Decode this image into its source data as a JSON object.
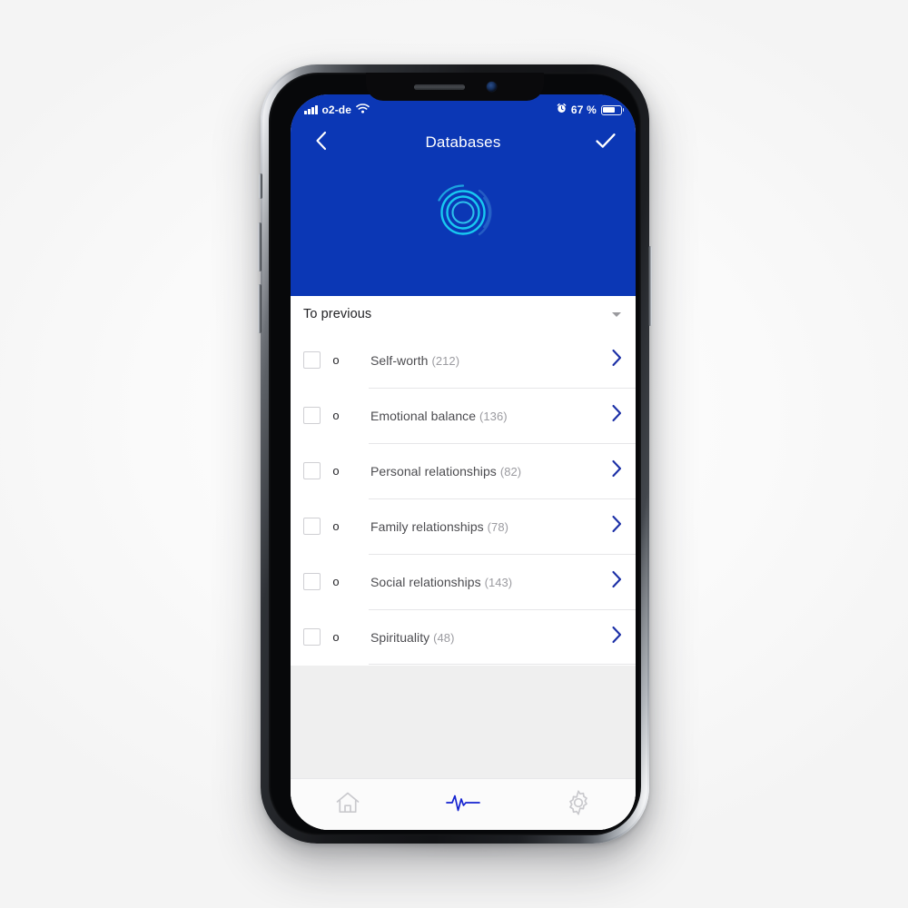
{
  "status_bar": {
    "carrier": "o2-de",
    "signal_icon": "signal-bars-icon",
    "wifi_icon": "wifi-icon",
    "alarm_icon": "alarm-clock-icon",
    "battery_text": "67 %",
    "battery_level_percent": 67,
    "battery_icon": "battery-icon"
  },
  "header": {
    "background_color": "#0b37b5",
    "back_icon": "chevron-left-icon",
    "title": "Databases",
    "done_icon": "checkmark-icon",
    "logo_name": "concentric-rings-logo",
    "logo_color": "#18c8f0"
  },
  "section": {
    "label": "To previous",
    "caret_icon": "chevron-down-icon"
  },
  "list": {
    "rows": [
      {
        "marker": "o",
        "label": "Self-worth",
        "count": "(212)",
        "checked": false
      },
      {
        "marker": "o",
        "label": "Emotional balance",
        "count": "(136)",
        "checked": false
      },
      {
        "marker": "o",
        "label": "Personal relationships",
        "count": "(82)",
        "checked": false
      },
      {
        "marker": "o",
        "label": "Family relationships",
        "count": "(78)",
        "checked": false
      },
      {
        "marker": "o",
        "label": "Social relationships",
        "count": "(143)",
        "checked": false
      },
      {
        "marker": "o",
        "label": "Spirituality",
        "count": "(48)",
        "checked": false
      }
    ],
    "chevron_icon": "chevron-right-icon",
    "chevron_color": "#1b2fa6"
  },
  "tab_bar": {
    "active_index": 1,
    "active_color": "#1422d0",
    "inactive_color": "#c9c9cd",
    "tabs": [
      {
        "icon": "home-icon",
        "active": false
      },
      {
        "icon": "pulse-activity-icon",
        "active": true
      },
      {
        "icon": "gear-settings-icon",
        "active": false
      }
    ]
  }
}
